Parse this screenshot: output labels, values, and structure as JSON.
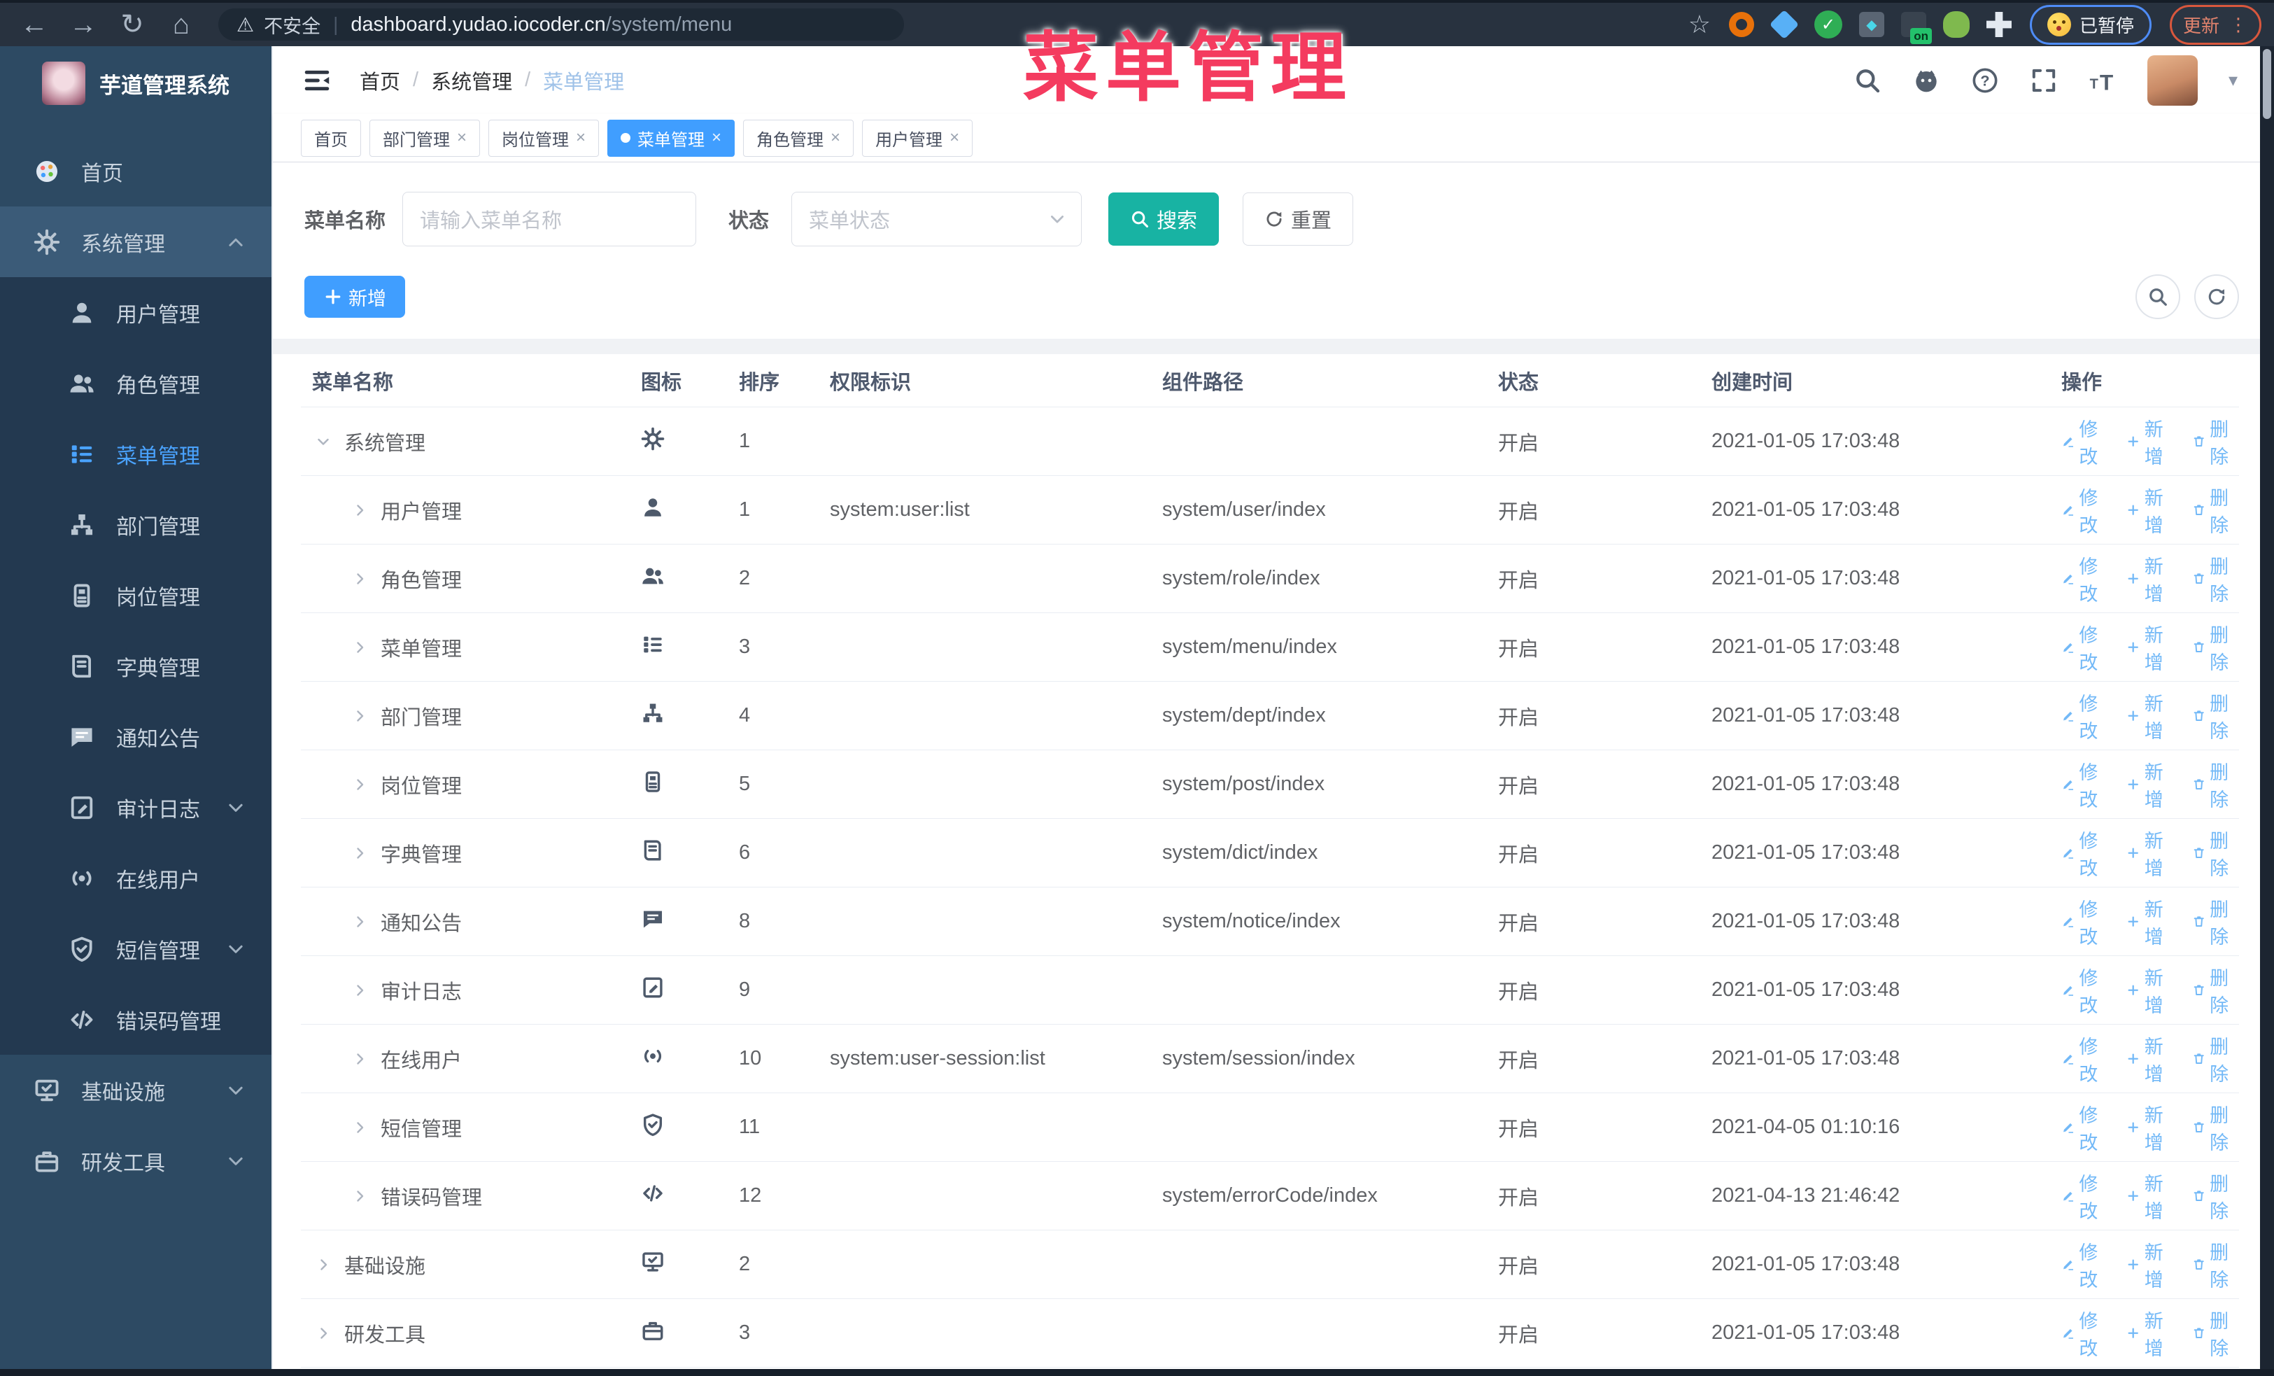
{
  "annotation": {
    "text": "菜单管理",
    "color": "#f43b5f"
  },
  "browser": {
    "security_label": "不安全",
    "url_host": "dashboard.yudao.iocoder.cn",
    "url_path": "/system/menu",
    "paused_label": "已暂停",
    "update_label": "更新",
    "nav_icons": [
      "back-icon",
      "forward-icon",
      "reload-icon",
      "home-icon"
    ],
    "extension_icons": [
      "orange-ring-extension-icon",
      "blue-gem-extension-icon",
      "green-check-extension-icon",
      "gray-toggles-extension-icon",
      "dark-on-extension-icon",
      "green-droid-extension-icon",
      "puzzle-extension-icon"
    ]
  },
  "sidebar": {
    "logo_title": "芋道管理系统",
    "items": [
      {
        "key": "home",
        "label": "首页",
        "icon": "dashboard-icon",
        "level": 0
      },
      {
        "key": "system",
        "label": "系统管理",
        "icon": "gear-icon",
        "level": 0,
        "chevron": "up",
        "open": true
      },
      {
        "key": "user",
        "label": "用户管理",
        "icon": "user-icon",
        "level": 1
      },
      {
        "key": "role",
        "label": "角色管理",
        "icon": "users-icon",
        "level": 1
      },
      {
        "key": "menu",
        "label": "菜单管理",
        "icon": "menu-list-icon",
        "level": 1,
        "active": true
      },
      {
        "key": "dept",
        "label": "部门管理",
        "icon": "tree-icon",
        "level": 1
      },
      {
        "key": "post",
        "label": "岗位管理",
        "icon": "badge-icon",
        "level": 1
      },
      {
        "key": "dict",
        "label": "字典管理",
        "icon": "book-icon",
        "level": 1
      },
      {
        "key": "notice",
        "label": "通知公告",
        "icon": "message-icon",
        "level": 1
      },
      {
        "key": "audit",
        "label": "审计日志",
        "icon": "log-icon",
        "level": 1,
        "chevron": "down"
      },
      {
        "key": "online",
        "label": "在线用户",
        "icon": "online-icon",
        "level": 1
      },
      {
        "key": "sms",
        "label": "短信管理",
        "icon": "shield-icon",
        "level": 1,
        "chevron": "down"
      },
      {
        "key": "errcode",
        "label": "错误码管理",
        "icon": "code-icon",
        "level": 1
      },
      {
        "key": "infra",
        "label": "基础设施",
        "icon": "monitor-icon",
        "level": 0,
        "chevron": "down"
      },
      {
        "key": "dev",
        "label": "研发工具",
        "icon": "briefcase-icon",
        "level": 0,
        "chevron": "down"
      }
    ]
  },
  "header": {
    "breadcrumb": [
      "首页",
      "系统管理",
      "菜单管理"
    ],
    "right_icons": [
      "search-icon",
      "github-icon",
      "help-icon",
      "fullscreen-icon",
      "fontsize-icon"
    ]
  },
  "tabs": [
    {
      "key": "home",
      "label": "首页"
    },
    {
      "key": "dept",
      "label": "部门管理",
      "closable": true
    },
    {
      "key": "post",
      "label": "岗位管理",
      "closable": true
    },
    {
      "key": "menu",
      "label": "菜单管理",
      "closable": true,
      "active": true
    },
    {
      "key": "role",
      "label": "角色管理",
      "closable": true
    },
    {
      "key": "user",
      "label": "用户管理",
      "closable": true
    }
  ],
  "filters": {
    "name_label": "菜单名称",
    "name_placeholder": "请输入菜单名称",
    "status_label": "状态",
    "status_placeholder": "菜单状态",
    "search_label": "搜索",
    "reset_label": "重置"
  },
  "toolbar": {
    "add_label": "新增"
  },
  "table": {
    "columns": [
      "菜单名称",
      "图标",
      "排序",
      "权限标识",
      "组件路径",
      "状态",
      "创建时间",
      "操作"
    ],
    "action_labels": {
      "edit": "修改",
      "add": "新增",
      "del": "删除"
    },
    "rows": [
      {
        "key": "system",
        "name": "系统管理",
        "icon": "gear-icon",
        "level": 0,
        "expanded": true,
        "sort": "1",
        "perm": "",
        "path": "",
        "status": "开启",
        "created": "2021-01-05 17:03:48"
      },
      {
        "key": "user",
        "name": "用户管理",
        "icon": "user-icon",
        "level": 1,
        "sort": "1",
        "perm": "system:user:list",
        "path": "system/user/index",
        "status": "开启",
        "created": "2021-01-05 17:03:48"
      },
      {
        "key": "role",
        "name": "角色管理",
        "icon": "users-icon",
        "level": 1,
        "sort": "2",
        "perm": "",
        "path": "system/role/index",
        "status": "开启",
        "created": "2021-01-05 17:03:48"
      },
      {
        "key": "menu",
        "name": "菜单管理",
        "icon": "menu-list-icon",
        "level": 1,
        "sort": "3",
        "perm": "",
        "path": "system/menu/index",
        "status": "开启",
        "created": "2021-01-05 17:03:48"
      },
      {
        "key": "dept",
        "name": "部门管理",
        "icon": "tree-icon",
        "level": 1,
        "sort": "4",
        "perm": "",
        "path": "system/dept/index",
        "status": "开启",
        "created": "2021-01-05 17:03:48"
      },
      {
        "key": "post",
        "name": "岗位管理",
        "icon": "badge-icon",
        "level": 1,
        "sort": "5",
        "perm": "",
        "path": "system/post/index",
        "status": "开启",
        "created": "2021-01-05 17:03:48"
      },
      {
        "key": "dict",
        "name": "字典管理",
        "icon": "book-icon",
        "level": 1,
        "sort": "6",
        "perm": "",
        "path": "system/dict/index",
        "status": "开启",
        "created": "2021-01-05 17:03:48"
      },
      {
        "key": "notice",
        "name": "通知公告",
        "icon": "message-icon",
        "level": 1,
        "sort": "8",
        "perm": "",
        "path": "system/notice/index",
        "status": "开启",
        "created": "2021-01-05 17:03:48"
      },
      {
        "key": "audit",
        "name": "审计日志",
        "icon": "log-icon",
        "level": 1,
        "sort": "9",
        "perm": "",
        "path": "",
        "status": "开启",
        "created": "2021-01-05 17:03:48"
      },
      {
        "key": "online",
        "name": "在线用户",
        "icon": "online-icon",
        "level": 1,
        "sort": "10",
        "perm": "system:user-session:list",
        "path": "system/session/index",
        "status": "开启",
        "created": "2021-01-05 17:03:48"
      },
      {
        "key": "sms",
        "name": "短信管理",
        "icon": "shield-icon",
        "level": 1,
        "sort": "11",
        "perm": "",
        "path": "",
        "status": "开启",
        "created": "2021-04-05 01:10:16"
      },
      {
        "key": "errcode",
        "name": "错误码管理",
        "icon": "code-icon",
        "level": 1,
        "sort": "12",
        "perm": "",
        "path": "system/errorCode/index",
        "status": "开启",
        "created": "2021-04-13 21:46:42"
      },
      {
        "key": "infra",
        "name": "基础设施",
        "icon": "monitor-icon",
        "level": 0,
        "sort": "2",
        "perm": "",
        "path": "",
        "status": "开启",
        "created": "2021-01-05 17:03:48"
      },
      {
        "key": "dev",
        "name": "研发工具",
        "icon": "briefcase-icon",
        "level": 0,
        "sort": "3",
        "perm": "",
        "path": "",
        "status": "开启",
        "created": "2021-01-05 17:03:48"
      }
    ]
  },
  "colors": {
    "accent": "#409eff",
    "search_teal": "#18b3a3",
    "annotation_red": "#f43b5f",
    "sidebar_bg": "#2d4a63"
  }
}
